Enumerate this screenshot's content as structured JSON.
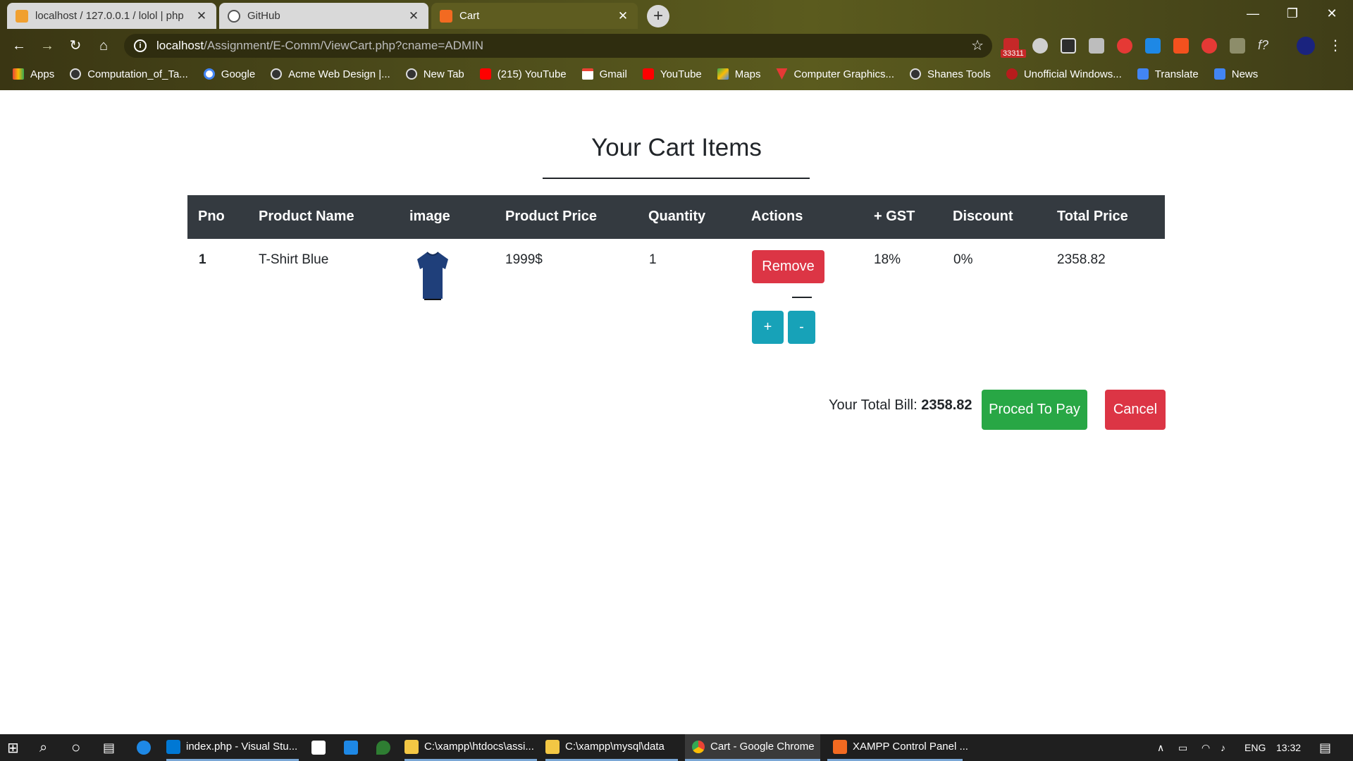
{
  "browser": {
    "tabs": [
      {
        "label": "localhost / 127.0.0.1 / lolol | php",
        "color": "#f0a030"
      },
      {
        "label": "GitHub",
        "color": "#ffffff"
      },
      {
        "label": "Cart",
        "color": "#f26a21"
      }
    ],
    "new_tab": "+",
    "window": {
      "minimize": "—",
      "restore": "❐",
      "close": "✕"
    },
    "url_host": "localhost",
    "url_path": "/Assignment/E-Comm/ViewCart.php?cname=ADMIN",
    "ext_badge": "33311",
    "bookmarks": [
      {
        "label": "Apps",
        "color": "#e94235"
      },
      {
        "label": "Computation_of_Ta...",
        "color": "#444"
      },
      {
        "label": "Google",
        "color": "#4285f4"
      },
      {
        "label": "Acme Web Design |...",
        "color": "#444"
      },
      {
        "label": "New Tab",
        "color": "#444"
      },
      {
        "label": "(215) YouTube",
        "color": "#ff0000"
      },
      {
        "label": "Gmail",
        "color": "#ea4335"
      },
      {
        "label": "YouTube",
        "color": "#ff0000"
      },
      {
        "label": "Maps",
        "color": "#34a853"
      },
      {
        "label": "Computer Graphics...",
        "color": "#e53935"
      },
      {
        "label": "Shanes Tools",
        "color": "#444"
      },
      {
        "label": "Unofficial Windows...",
        "color": "#b71c1c"
      },
      {
        "label": "Translate",
        "color": "#4285f4"
      },
      {
        "label": "News",
        "color": "#4285f4"
      }
    ]
  },
  "page": {
    "heading": "Your Cart Items",
    "columns": [
      "Pno",
      "Product Name",
      "image",
      "Product Price",
      "Quantity",
      "Actions",
      "+ GST",
      "Discount",
      "Total Price"
    ],
    "row": {
      "pno": "1",
      "name": "T-Shirt Blue",
      "price": "1999$",
      "quantity": "1",
      "remove": "Remove",
      "plus": "+",
      "minus": "-",
      "gst": "18%",
      "discount": "0%",
      "total": "2358.82"
    },
    "bill_label": "Your Total Bill: ",
    "bill_value": "2358.82",
    "pay_button": "Proced To Pay",
    "cancel_button": "Cancel"
  },
  "taskbar": {
    "apps": [
      {
        "label": "index.php - Visual Stu...",
        "color": "#0078d4"
      },
      {
        "label": "C:\\xampp\\htdocs\\assi...",
        "color": "#f3c744"
      },
      {
        "label": "C:\\xampp\\mysql\\data",
        "color": "#f3c744"
      },
      {
        "label": "Cart - Google Chrome",
        "color": "#4caf50"
      },
      {
        "label": "XAMPP Control Panel ...",
        "color": "#f26a21"
      }
    ],
    "lang": "ENG",
    "time": "13:32"
  }
}
